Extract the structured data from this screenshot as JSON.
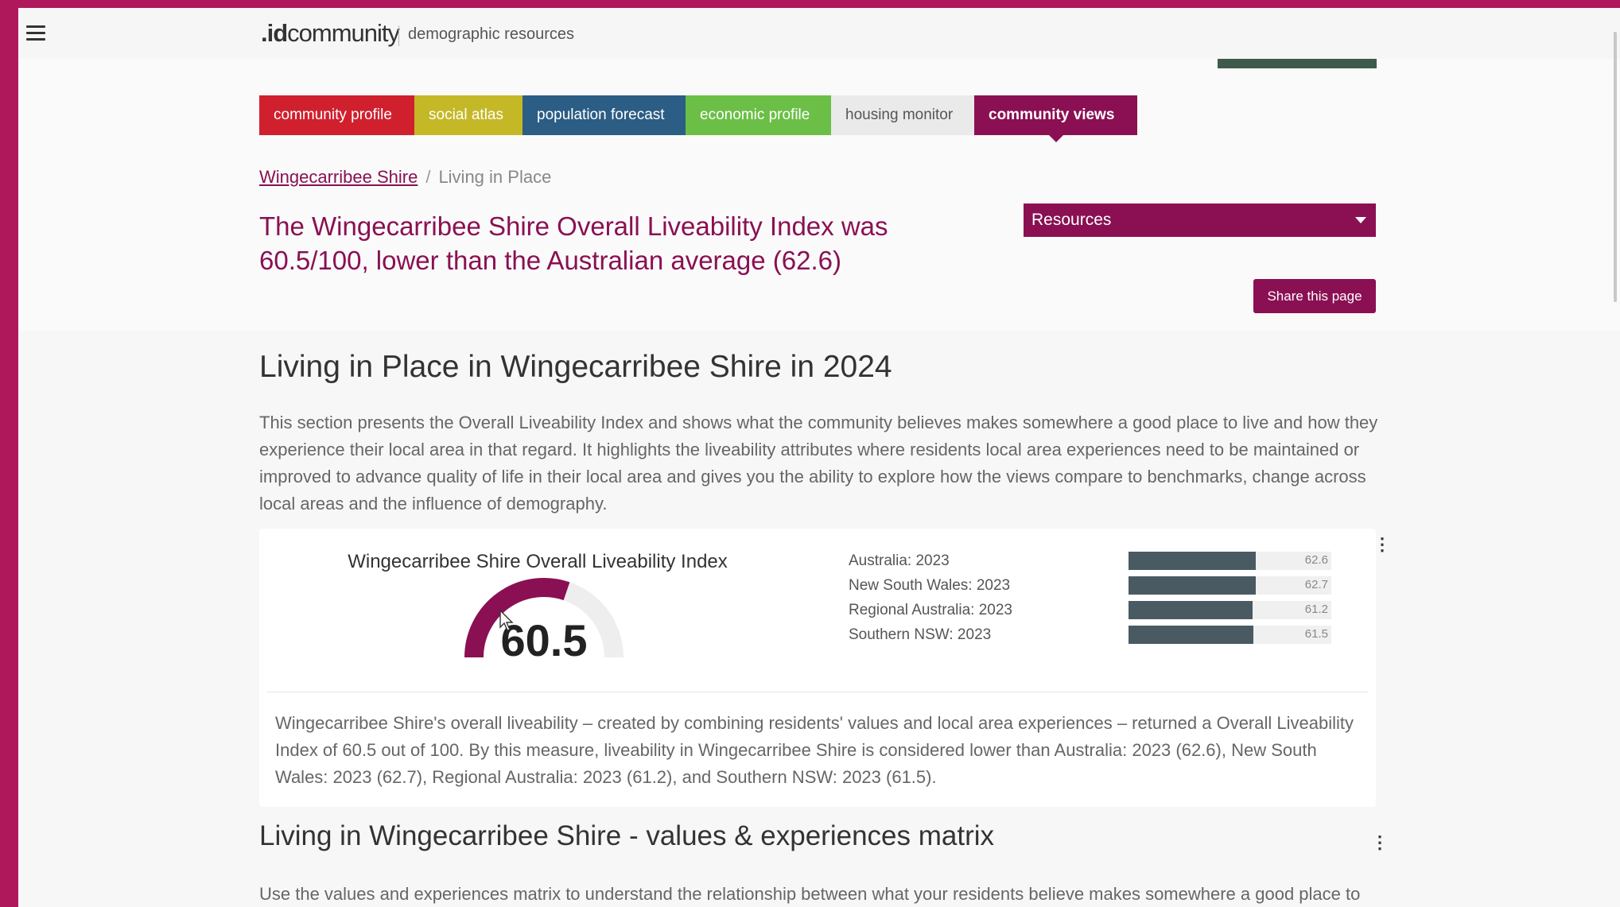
{
  "header": {
    "logo_id": ".id",
    "logo_community": "community",
    "tagline": "demographic resources"
  },
  "tabs": [
    {
      "label": "community profile",
      "color": "#d0202e"
    },
    {
      "label": "social atlas",
      "color": "#c5b827"
    },
    {
      "label": "population forecast",
      "color": "#2c5d84"
    },
    {
      "label": "economic profile",
      "color": "#6bbf46"
    },
    {
      "label": "housing monitor",
      "color": "#eaeaea"
    },
    {
      "label": "community views",
      "color": "#8a1053",
      "active": true
    }
  ],
  "breadcrumb": {
    "home": "Wingecarribee Shire",
    "current": "Living in Place"
  },
  "headline": "The Wingecarribee Shire Overall Liveability Index was 60.5/100, lower than the Australian average (62.6)",
  "resources_label": "Resources",
  "share_label": "Share this page",
  "section_title": "Living in Place in Wingecarribee Shire in 2024",
  "intro": "This section presents the Overall Liveability Index and shows what the community believes makes somewhere a good place to live and how they experience their local area in that regard. It highlights the liveability attributes where residents local area experiences need to be maintained or improved to advance quality of life in their local area and gives you the ability to explore how the views compare to benchmarks, change across local areas and the influence of demography.",
  "gauge": {
    "title": "Wingecarribee Shire Overall Liveability Index",
    "value": 60.5,
    "value_label": "60.5",
    "max": 100,
    "fill_color": "#8a1053",
    "track_color": "#eeeeee"
  },
  "benchmarks": [
    {
      "label": "Australia: 2023",
      "value": 62.6,
      "value_label": "62.6"
    },
    {
      "label": "New South Wales: 2023",
      "value": 62.7,
      "value_label": "62.7"
    },
    {
      "label": "Regional Australia: 2023",
      "value": 61.2,
      "value_label": "61.2"
    },
    {
      "label": "Southern NSW: 2023",
      "value": 61.5,
      "value_label": "61.5"
    }
  ],
  "card_text": "Wingecarribee Shire's overall liveability – created by combining residents' values and local area experiences – returned a Overall Liveability Index of 60.5 out of 100. By this measure, liveability in Wingecarribee Shire is considered lower than Australia: 2023 (62.6), New South Wales: 2023 (62.7), Regional Australia: 2023 (61.2), and Southern NSW: 2023 (61.5).",
  "matrix_title": "Living in Wingecarribee Shire - values & experiences matrix",
  "matrix_intro": "Use the values and experiences matrix to understand the relationship between what your residents believe makes somewhere a good place to"
}
